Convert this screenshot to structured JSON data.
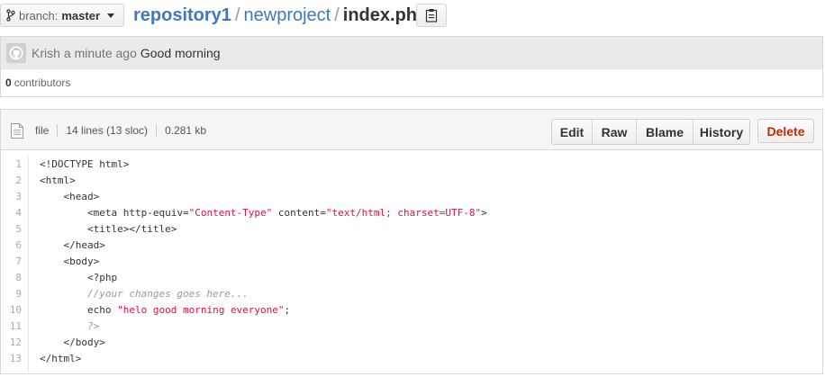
{
  "branch": {
    "label": "branch:",
    "name": "master"
  },
  "breadcrumb": {
    "repo": "repository1",
    "sep1": "/",
    "dir": "newproject",
    "sep2": "/",
    "file": "index.php"
  },
  "commit": {
    "author": "Krish",
    "time": "a minute ago",
    "message": "Good morning"
  },
  "contributors": {
    "count": "0",
    "label": "contributors"
  },
  "file_info": {
    "type": "file",
    "lines": "14 lines (13 sloc)",
    "size": "0.281 kb"
  },
  "toolbar": {
    "edit": "Edit",
    "raw": "Raw",
    "blame": "Blame",
    "history": "History",
    "delete": "Delete"
  },
  "colors": {
    "link": "#4078c0",
    "delete": "#bd2c00",
    "string": "#dd1144",
    "comment": "#999999"
  },
  "code": {
    "line_numbers": [
      "1",
      "2",
      "3",
      "4",
      "5",
      "6",
      "7",
      "8",
      "9",
      "10",
      "11",
      "12",
      "13"
    ],
    "lines": [
      {
        "indent": "",
        "parts": [
          {
            "t": "<!DOCTYPE html>",
            "c": ""
          }
        ]
      },
      {
        "indent": "",
        "parts": [
          {
            "t": "<html>",
            "c": ""
          }
        ]
      },
      {
        "indent": "    ",
        "parts": [
          {
            "t": "<head>",
            "c": ""
          }
        ]
      },
      {
        "indent": "        ",
        "parts": [
          {
            "t": "<meta http-equiv=",
            "c": ""
          },
          {
            "t": "\"Content-Type\"",
            "c": "str"
          },
          {
            "t": " content=",
            "c": ""
          },
          {
            "t": "\"text/html; charset=UTF-8\"",
            "c": "str"
          },
          {
            "t": ">",
            "c": ""
          }
        ]
      },
      {
        "indent": "        ",
        "parts": [
          {
            "t": "<title></title>",
            "c": ""
          }
        ]
      },
      {
        "indent": "    ",
        "parts": [
          {
            "t": "</head>",
            "c": ""
          }
        ]
      },
      {
        "indent": "    ",
        "parts": [
          {
            "t": "<body>",
            "c": ""
          }
        ]
      },
      {
        "indent": "        ",
        "parts": [
          {
            "t": "<?php",
            "c": ""
          }
        ]
      },
      {
        "indent": "        ",
        "parts": [
          {
            "t": "//your changes goes here...",
            "c": "cmt"
          }
        ]
      },
      {
        "indent": "        ",
        "parts": [
          {
            "t": "echo ",
            "c": ""
          },
          {
            "t": "\"helo good morning everyone\"",
            "c": "str"
          },
          {
            "t": ";",
            "c": ""
          }
        ]
      },
      {
        "indent": "        ",
        "parts": [
          {
            "t": "?>",
            "c": "cmt"
          }
        ]
      },
      {
        "indent": "    ",
        "parts": [
          {
            "t": "</body>",
            "c": ""
          }
        ]
      },
      {
        "indent": "",
        "parts": [
          {
            "t": "</html>",
            "c": ""
          }
        ]
      }
    ]
  }
}
